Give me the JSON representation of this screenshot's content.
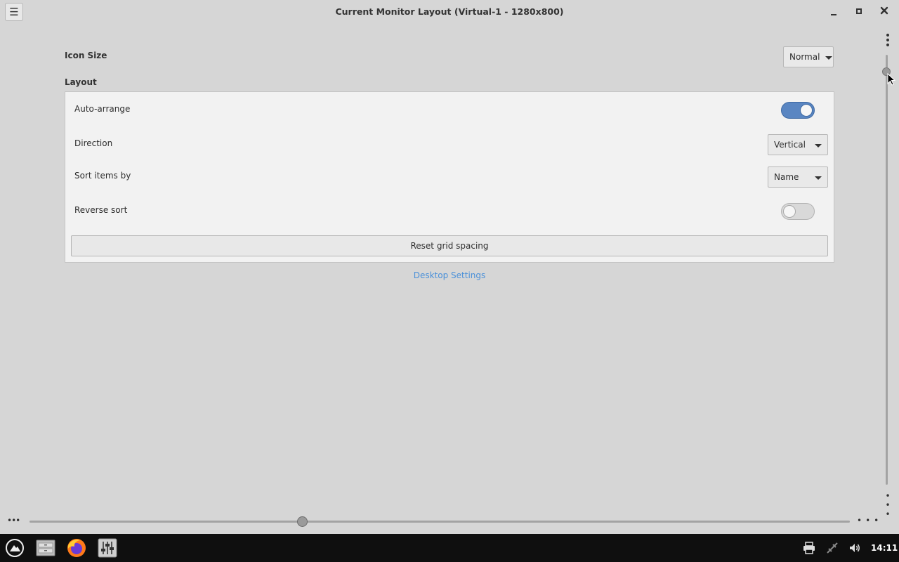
{
  "window": {
    "title": "Current Monitor Layout (Virtual-1 - 1280x800)",
    "menu_icon": "hamburger-icon",
    "controls": [
      "minimize-icon",
      "maximize-icon",
      "close-icon"
    ]
  },
  "icon_size": {
    "label": "Icon Size",
    "value": "Normal"
  },
  "layout": {
    "heading": "Layout",
    "auto_arrange": {
      "label": "Auto-arrange",
      "on": true
    },
    "direction": {
      "label": "Direction",
      "value": "Vertical"
    },
    "sort_by": {
      "label": "Sort items by",
      "value": "Name"
    },
    "reverse_sort": {
      "label": "Reverse sort",
      "on": false
    },
    "reset_button": "Reset grid spacing"
  },
  "link": "Desktop Settings",
  "taskbar": {
    "apps": [
      "start-menu-icon",
      "file-manager-icon",
      "firefox-icon",
      "settings-mixer-icon"
    ],
    "tray": [
      "printer-icon",
      "network-disconnected-icon",
      "volume-icon"
    ],
    "clock": "14:11"
  },
  "colors": {
    "accent": "#5a86c2",
    "link": "#4a90d9",
    "background": "#d6d6d6",
    "panel": "#f2f2f2",
    "taskbar": "#0f0f0f"
  }
}
